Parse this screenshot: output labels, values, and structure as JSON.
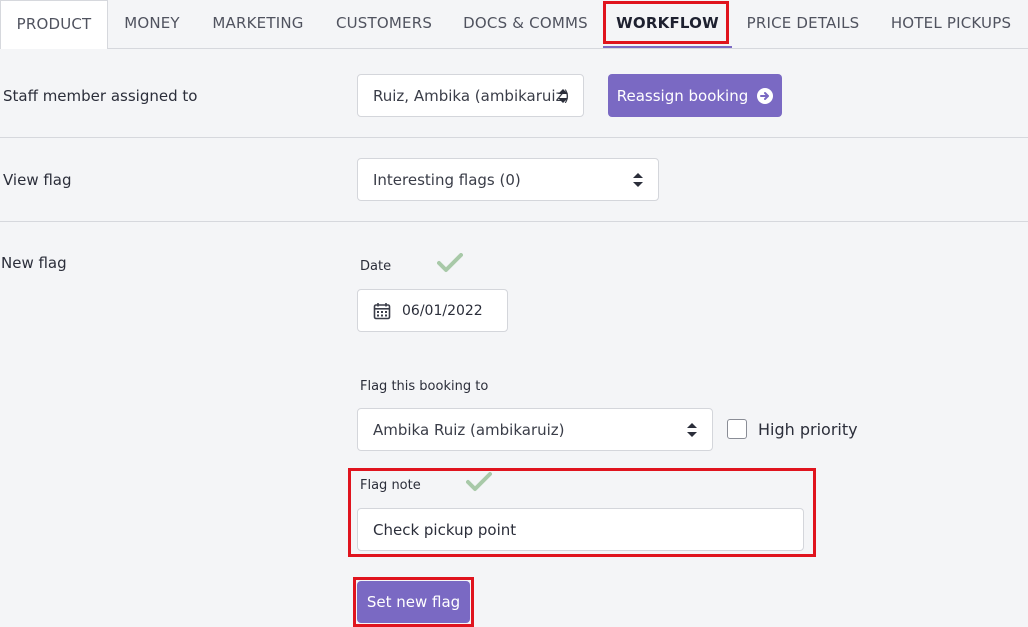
{
  "tabs": [
    {
      "label": "PRODUCT"
    },
    {
      "label": "MONEY"
    },
    {
      "label": "MARKETING"
    },
    {
      "label": "CUSTOMERS"
    },
    {
      "label": "DOCS & COMMS"
    },
    {
      "label": "WORKFLOW"
    },
    {
      "label": "PRICE DETAILS"
    },
    {
      "label": "HOTEL PICKUPS"
    }
  ],
  "staff": {
    "label": "Staff member assigned to",
    "selected": "Ruiz, Ambika (ambikaruiz)",
    "reassign_label": "Reassign booking"
  },
  "view_flag": {
    "label": "View flag",
    "selected": "Interesting flags (0)"
  },
  "new_flag": {
    "label": "New flag",
    "date_label": "Date",
    "date_value": "06/01/2022",
    "assignee_label": "Flag this booking to",
    "assignee_selected": "Ambika Ruiz (ambikaruiz)",
    "high_priority_label": "High priority",
    "high_priority_checked": false,
    "note_label": "Flag note",
    "note_value": "Check pickup point",
    "submit_label": "Set new flag"
  },
  "colors": {
    "accent": "#7a69c3",
    "highlight": "#e0141e",
    "valid_check": "#a8c9a8"
  }
}
